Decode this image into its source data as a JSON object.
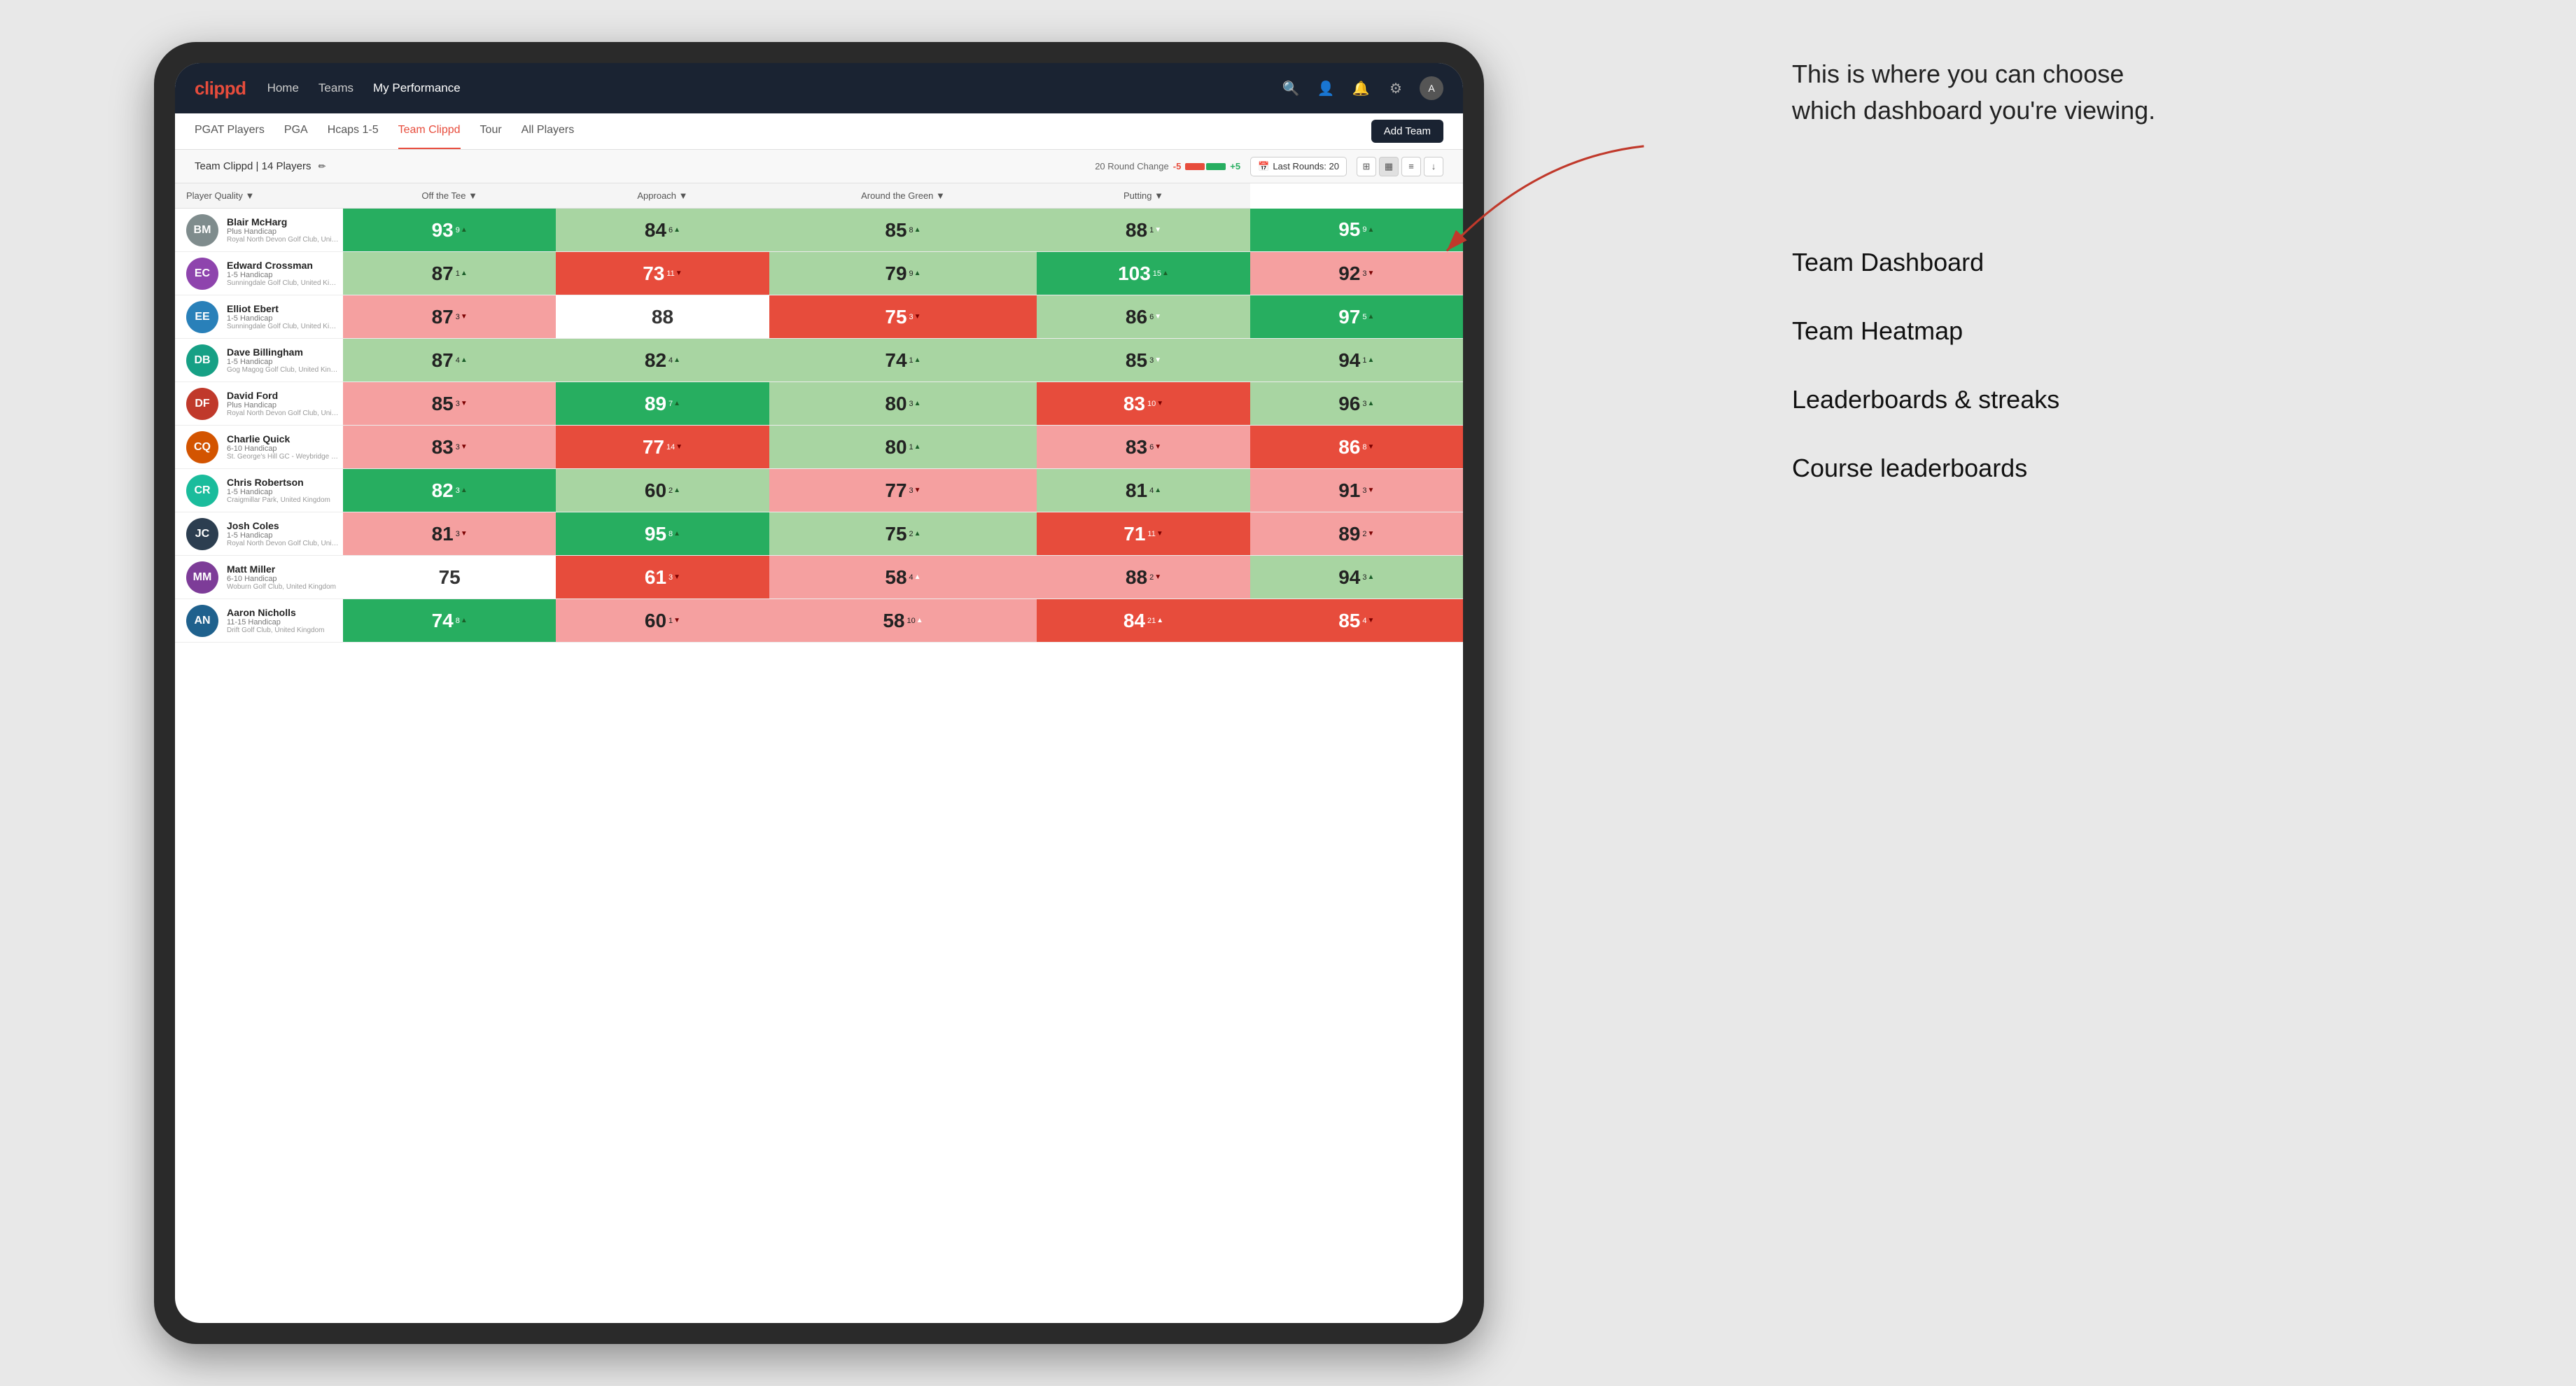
{
  "annotation": {
    "callout": "This is where you can choose which dashboard you're viewing.",
    "items": [
      "Team Dashboard",
      "Team Heatmap",
      "Leaderboards & streaks",
      "Course leaderboards"
    ]
  },
  "navbar": {
    "logo": "clippd",
    "links": [
      "Home",
      "Teams",
      "My Performance"
    ],
    "active_link": "My Performance"
  },
  "subnav": {
    "tabs": [
      "PGAT Players",
      "PGA",
      "Hcaps 1-5",
      "Team Clippd",
      "Tour",
      "All Players"
    ],
    "active_tab": "Team Clippd",
    "add_team_label": "Add Team"
  },
  "team_header": {
    "name": "Team Clippd",
    "players_count": "14 Players",
    "round_change_label": "20 Round Change",
    "round_change_neg": "-5",
    "round_change_pos": "+5",
    "last_rounds_label": "Last Rounds: 20"
  },
  "table": {
    "columns": [
      "Player Quality ↓",
      "Off the Tee ↓",
      "Approach ↓",
      "Around the Green ↓",
      "Putting ↓"
    ],
    "players": [
      {
        "name": "Blair McHarg",
        "hcap": "Plus Handicap",
        "club": "Royal North Devon Golf Club, United Kingdom",
        "scores": [
          {
            "val": "93",
            "change": "9",
            "dir": "up",
            "color": "dark-green"
          },
          {
            "val": "84",
            "change": "6",
            "dir": "up",
            "color": "light-green"
          },
          {
            "val": "85",
            "change": "8",
            "dir": "up",
            "color": "light-green"
          },
          {
            "val": "88",
            "change": "1",
            "dir": "down",
            "color": "light-green"
          },
          {
            "val": "95",
            "change": "9",
            "dir": "up",
            "color": "dark-green"
          }
        ]
      },
      {
        "name": "Edward Crossman",
        "hcap": "1-5 Handicap",
        "club": "Sunningdale Golf Club, United Kingdom",
        "scores": [
          {
            "val": "87",
            "change": "1",
            "dir": "up",
            "color": "light-green"
          },
          {
            "val": "73",
            "change": "11",
            "dir": "down",
            "color": "dark-red"
          },
          {
            "val": "79",
            "change": "9",
            "dir": "up",
            "color": "light-green"
          },
          {
            "val": "103",
            "change": "15",
            "dir": "up",
            "color": "dark-green"
          },
          {
            "val": "92",
            "change": "3",
            "dir": "down",
            "color": "light-red"
          }
        ]
      },
      {
        "name": "Elliot Ebert",
        "hcap": "1-5 Handicap",
        "club": "Sunningdale Golf Club, United Kingdom",
        "scores": [
          {
            "val": "87",
            "change": "3",
            "dir": "down",
            "color": "light-red"
          },
          {
            "val": "88",
            "change": "",
            "dir": "",
            "color": "white"
          },
          {
            "val": "75",
            "change": "3",
            "dir": "down",
            "color": "dark-red"
          },
          {
            "val": "86",
            "change": "6",
            "dir": "down",
            "color": "light-green"
          },
          {
            "val": "97",
            "change": "5",
            "dir": "up",
            "color": "dark-green"
          }
        ]
      },
      {
        "name": "Dave Billingham",
        "hcap": "1-5 Handicap",
        "club": "Gog Magog Golf Club, United Kingdom",
        "scores": [
          {
            "val": "87",
            "change": "4",
            "dir": "up",
            "color": "light-green"
          },
          {
            "val": "82",
            "change": "4",
            "dir": "up",
            "color": "light-green"
          },
          {
            "val": "74",
            "change": "1",
            "dir": "up",
            "color": "light-green"
          },
          {
            "val": "85",
            "change": "3",
            "dir": "down",
            "color": "light-green"
          },
          {
            "val": "94",
            "change": "1",
            "dir": "up",
            "color": "light-green"
          }
        ]
      },
      {
        "name": "David Ford",
        "hcap": "Plus Handicap",
        "club": "Royal North Devon Golf Club, United Kingdom",
        "scores": [
          {
            "val": "85",
            "change": "3",
            "dir": "down",
            "color": "light-red"
          },
          {
            "val": "89",
            "change": "7",
            "dir": "up",
            "color": "dark-green"
          },
          {
            "val": "80",
            "change": "3",
            "dir": "up",
            "color": "light-green"
          },
          {
            "val": "83",
            "change": "10",
            "dir": "down",
            "color": "dark-red"
          },
          {
            "val": "96",
            "change": "3",
            "dir": "up",
            "color": "light-green"
          }
        ]
      },
      {
        "name": "Charlie Quick",
        "hcap": "6-10 Handicap",
        "club": "St. George's Hill GC - Weybridge - Surrey, Uni...",
        "scores": [
          {
            "val": "83",
            "change": "3",
            "dir": "down",
            "color": "light-red"
          },
          {
            "val": "77",
            "change": "14",
            "dir": "down",
            "color": "dark-red"
          },
          {
            "val": "80",
            "change": "1",
            "dir": "up",
            "color": "light-green"
          },
          {
            "val": "83",
            "change": "6",
            "dir": "down",
            "color": "light-red"
          },
          {
            "val": "86",
            "change": "8",
            "dir": "down",
            "color": "dark-red"
          }
        ]
      },
      {
        "name": "Chris Robertson",
        "hcap": "1-5 Handicap",
        "club": "Craigmillar Park, United Kingdom",
        "scores": [
          {
            "val": "82",
            "change": "3",
            "dir": "up",
            "color": "dark-green"
          },
          {
            "val": "60",
            "change": "2",
            "dir": "up",
            "color": "light-green"
          },
          {
            "val": "77",
            "change": "3",
            "dir": "down",
            "color": "light-red"
          },
          {
            "val": "81",
            "change": "4",
            "dir": "up",
            "color": "light-green"
          },
          {
            "val": "91",
            "change": "3",
            "dir": "down",
            "color": "light-red"
          }
        ]
      },
      {
        "name": "Josh Coles",
        "hcap": "1-5 Handicap",
        "club": "Royal North Devon Golf Club, United Kingdom",
        "scores": [
          {
            "val": "81",
            "change": "3",
            "dir": "down",
            "color": "light-red"
          },
          {
            "val": "95",
            "change": "8",
            "dir": "up",
            "color": "dark-green"
          },
          {
            "val": "75",
            "change": "2",
            "dir": "up",
            "color": "light-green"
          },
          {
            "val": "71",
            "change": "11",
            "dir": "down",
            "color": "dark-red"
          },
          {
            "val": "89",
            "change": "2",
            "dir": "down",
            "color": "light-red"
          }
        ]
      },
      {
        "name": "Matt Miller",
        "hcap": "6-10 Handicap",
        "club": "Woburn Golf Club, United Kingdom",
        "scores": [
          {
            "val": "75",
            "change": "",
            "dir": "",
            "color": "white"
          },
          {
            "val": "61",
            "change": "3",
            "dir": "down",
            "color": "dark-red"
          },
          {
            "val": "58",
            "change": "4",
            "dir": "up",
            "color": "light-red"
          },
          {
            "val": "88",
            "change": "2",
            "dir": "down",
            "color": "light-red"
          },
          {
            "val": "94",
            "change": "3",
            "dir": "up",
            "color": "light-green"
          }
        ]
      },
      {
        "name": "Aaron Nicholls",
        "hcap": "11-15 Handicap",
        "club": "Drift Golf Club, United Kingdom",
        "scores": [
          {
            "val": "74",
            "change": "8",
            "dir": "up",
            "color": "dark-green"
          },
          {
            "val": "60",
            "change": "1",
            "dir": "down",
            "color": "light-red"
          },
          {
            "val": "58",
            "change": "10",
            "dir": "up",
            "color": "light-red"
          },
          {
            "val": "84",
            "change": "21",
            "dir": "up",
            "color": "dark-red"
          },
          {
            "val": "85",
            "change": "4",
            "dir": "down",
            "color": "dark-red"
          }
        ]
      }
    ]
  }
}
